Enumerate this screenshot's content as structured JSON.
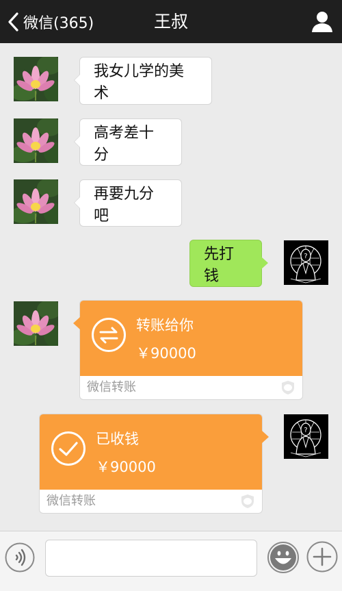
{
  "header": {
    "back_label": "微信(365)",
    "title": "王叔"
  },
  "messages": [
    {
      "side": "left",
      "text": "我女儿学的美术"
    },
    {
      "side": "left",
      "text": "高考差十分"
    },
    {
      "side": "left",
      "text": "再要九分吧"
    },
    {
      "side": "right",
      "text": "先打钱"
    }
  ],
  "transfer_sent": {
    "title": "转账给你",
    "amount": "￥90000",
    "footer": "微信转账"
  },
  "transfer_received": {
    "title": "已收钱",
    "amount": "￥90000",
    "footer": "微信转账"
  },
  "input": {
    "value": "",
    "placeholder": ""
  },
  "colors": {
    "topbar": "#1f1f1f",
    "background": "#ebebeb",
    "sent_bubble": "#a0e75a",
    "transfer_card": "#fa9e3b"
  },
  "icons": {
    "back": "chevron-left-icon",
    "profile": "person-icon",
    "voice": "voice-icon",
    "emoji": "smiley-icon",
    "more": "plus-icon",
    "transfer": "transfer-arrows-icon",
    "received": "checkmark-icon",
    "wechat_shield": "shield-icon"
  }
}
